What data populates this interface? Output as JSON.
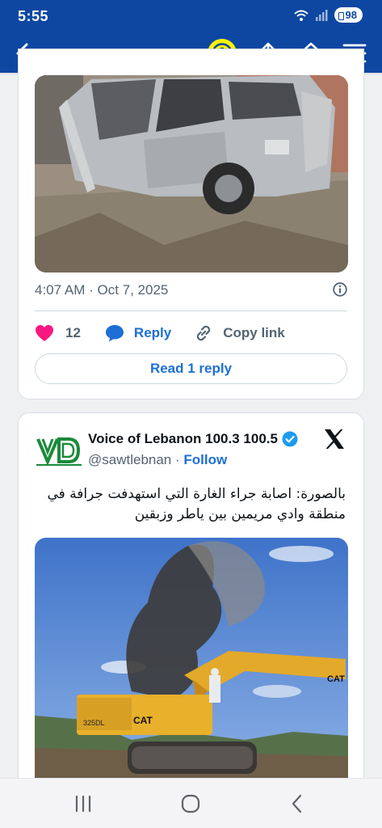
{
  "status_bar": {
    "time": "5:55",
    "battery": "98"
  },
  "app_bar": {
    "back_icon": "chevron-left-icon",
    "account_icon": "account-icon",
    "share_icon": "share-icon",
    "home_icon": "home-icon",
    "menu_icon": "menu-icon",
    "accent_color": "#0d47a1",
    "avatar_color": "#fff200"
  },
  "tweet1": {
    "timestamp": "4:07 AM · Oct 7, 2025",
    "likes": "12",
    "reply_label": "Reply",
    "copy_link_label": "Copy link",
    "read_reply_label": "Read 1 reply"
  },
  "tweet2": {
    "author": "Voice of Lebanon 100.3 100.5",
    "handle": "@sawtlebnan",
    "separator": "·",
    "follow_label": "Follow",
    "text": "بالصورة: اصابة جراء الغارة التي استهدفت جرافة في منطقة وادي مريمين بين ياطر وزبقين",
    "excavator_brand": "CAT",
    "excavator_model": "325DL"
  },
  "colors": {
    "link": "#1d6fd6",
    "heart": "#f91880",
    "muted": "#536471"
  }
}
